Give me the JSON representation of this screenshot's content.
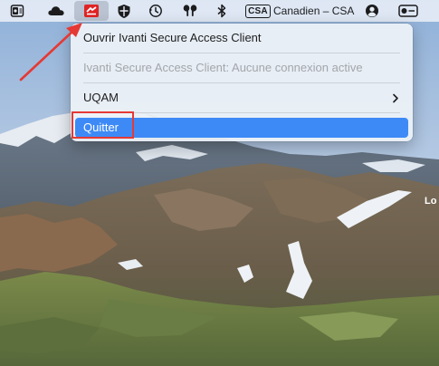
{
  "menubar": {
    "icons": [
      {
        "name": "outlook-icon"
      },
      {
        "name": "cloud-icon"
      },
      {
        "name": "ivanti-secure-access-icon"
      },
      {
        "name": "shield-icon"
      },
      {
        "name": "time-machine-icon"
      },
      {
        "name": "airpods-icon"
      },
      {
        "name": "bluetooth-icon"
      },
      {
        "name": "user-account-icon"
      },
      {
        "name": "toggle-control-icon"
      }
    ],
    "input_source": {
      "badge": "CSA",
      "label": "Canadien – CSA"
    }
  },
  "menu": {
    "open_client": "Ouvrir Ivanti Secure Access Client",
    "status": "Ivanti Secure Access Client:  Aucune connexion active",
    "uqam": "UQAM",
    "quit": "Quitter"
  },
  "desktop": {
    "edge_text": "Lo"
  },
  "colors": {
    "highlight": "#3d8af7",
    "annotation": "#e53935",
    "menubar": "#e8eef6"
  }
}
